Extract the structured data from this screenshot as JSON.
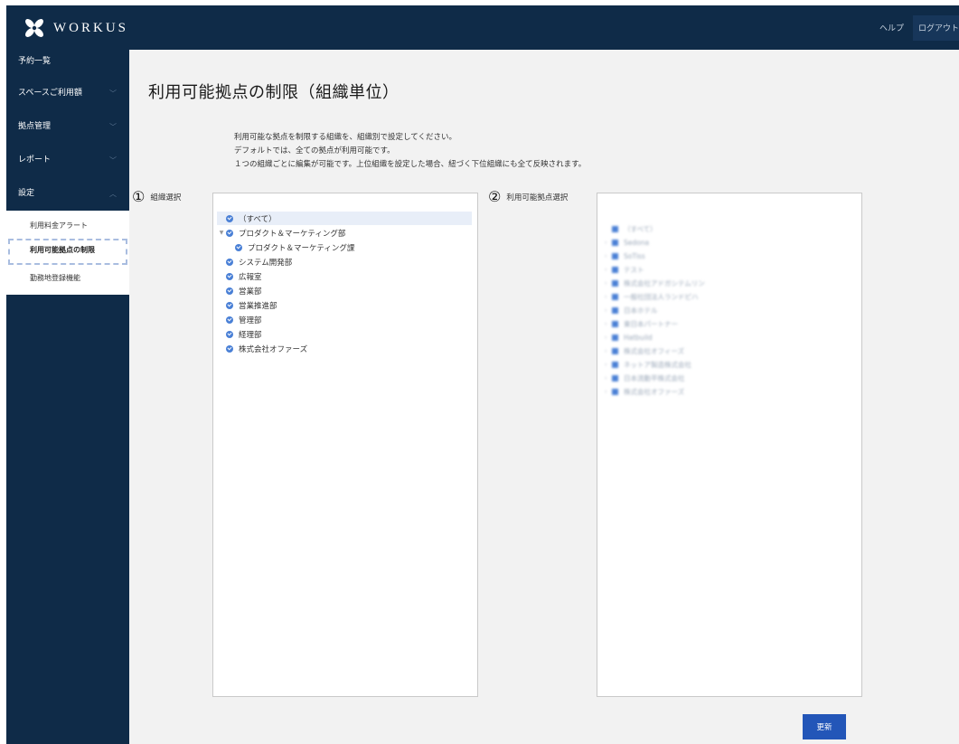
{
  "header": {
    "brand": "WORKUS",
    "help": "ヘルプ",
    "logout": "ログアウト",
    "colors": {
      "bar": "#0f2b48",
      "accent": "#2356b8"
    }
  },
  "sidebar": {
    "items": [
      {
        "label": "予約一覧",
        "chevron": ""
      },
      {
        "label": "スペースご利用額",
        "chevron": "chevron-down-icon"
      },
      {
        "label": "拠点管理",
        "chevron": "chevron-down-icon"
      },
      {
        "label": "レポート",
        "chevron": "chevron-down-icon"
      },
      {
        "label": "設定",
        "chevron": "chevron-up-icon"
      }
    ],
    "submenu": [
      {
        "label": "利用料金アラート"
      },
      {
        "label": "利用可能拠点の制限",
        "active": true
      },
      {
        "label": "勤務地登録機能"
      }
    ]
  },
  "main": {
    "title": "利用可能拠点の制限（組織単位）",
    "description": [
      "利用可能な拠点を制限する組織を、組織別で設定してください。",
      "デフォルトでは、全ての拠点が利用可能です。",
      "１つの組織ごとに編集が可能です。上位組織を設定した場合、紐づく下位組織にも全て反映されます。"
    ],
    "org_panel": {
      "number": "①",
      "label": "組織選択",
      "tree": [
        {
          "label": "（すべて）",
          "selected": true
        },
        {
          "label": "プロダクト＆マーケティング部",
          "expanded": true
        },
        {
          "label": "プロダクト＆マーケティング課"
        },
        {
          "label": "システム開発部"
        },
        {
          "label": "広報室"
        },
        {
          "label": "営業部"
        },
        {
          "label": "営業推進部"
        },
        {
          "label": "管理部"
        },
        {
          "label": "経理部"
        },
        {
          "label": "株式会社オファーズ"
        }
      ]
    },
    "base_panel": {
      "number": "②",
      "label": "利用可能拠点選択",
      "items": [
        "（すべて）",
        "Sedona",
        "SoTiss",
        "テスト",
        "株式会社アドガシテムリン",
        "一般社団法人ランドピハ",
        "日本ホテル",
        "東日本パートナー",
        "Hatbuild",
        "株式会社オフィーズ",
        "ネットア製造株式会社",
        "日本流動平株式会社",
        "株式会社オファーズ"
      ]
    },
    "update_button": "更新"
  }
}
